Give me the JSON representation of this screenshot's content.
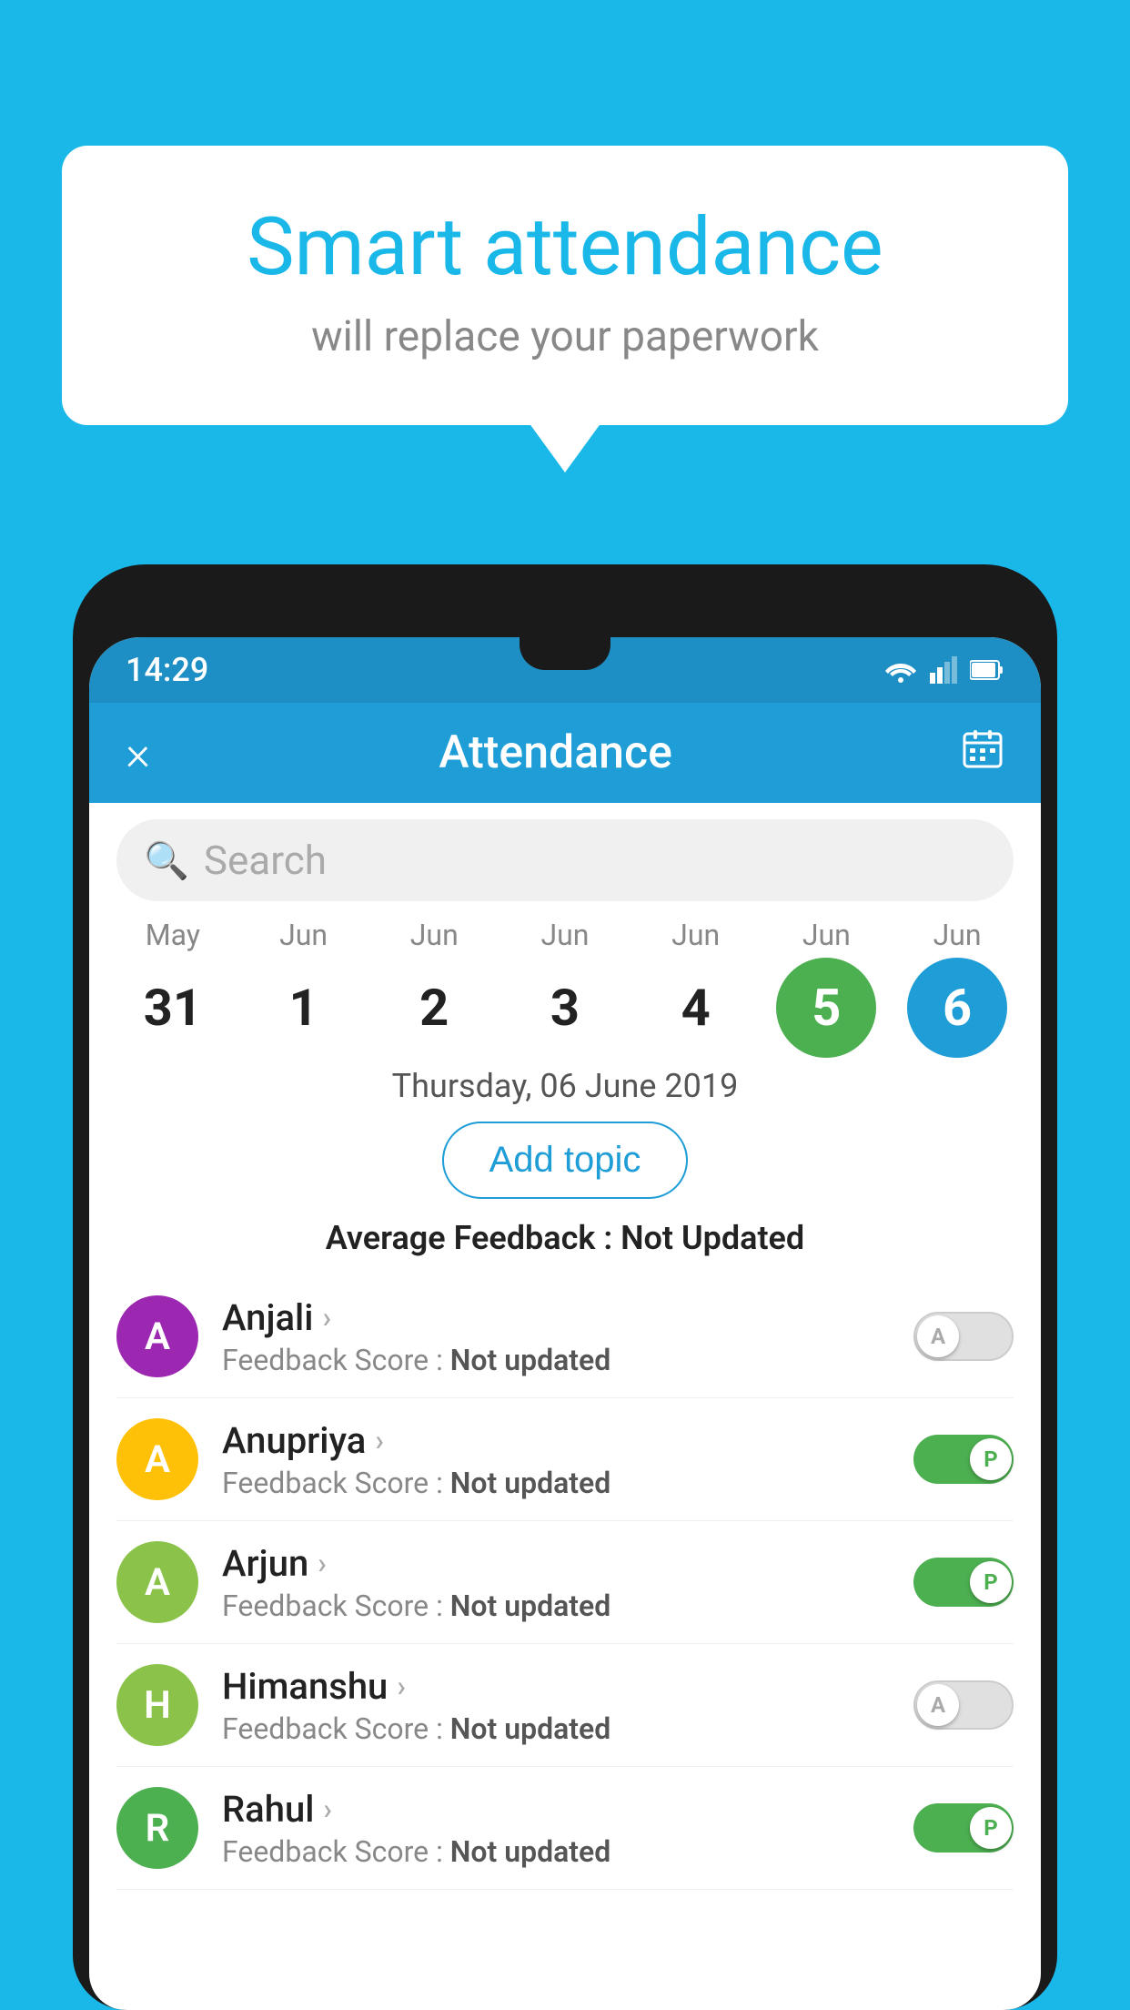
{
  "background_color": "#1ab8e8",
  "speech_bubble": {
    "title": "Smart attendance",
    "subtitle": "will replace your paperwork"
  },
  "status_bar": {
    "time": "14:29"
  },
  "app_bar": {
    "close_label": "×",
    "title": "Attendance",
    "calendar_icon": "📅"
  },
  "search": {
    "placeholder": "Search"
  },
  "calendar": {
    "days": [
      {
        "month": "May",
        "date": "31",
        "state": "normal"
      },
      {
        "month": "Jun",
        "date": "1",
        "state": "normal"
      },
      {
        "month": "Jun",
        "date": "2",
        "state": "normal"
      },
      {
        "month": "Jun",
        "date": "3",
        "state": "normal"
      },
      {
        "month": "Jun",
        "date": "4",
        "state": "normal"
      },
      {
        "month": "Jun",
        "date": "5",
        "state": "today"
      },
      {
        "month": "Jun",
        "date": "6",
        "state": "selected"
      }
    ]
  },
  "selected_date_label": "Thursday, 06 June 2019",
  "add_topic_label": "Add topic",
  "avg_feedback": {
    "label": "Average Feedback :",
    "value": "Not Updated"
  },
  "students": [
    {
      "name": "Anjali",
      "avatar_letter": "A",
      "avatar_color": "#9c27b0",
      "feedback_label": "Feedback Score :",
      "feedback_value": "Not updated",
      "toggle": "off",
      "toggle_label": "A"
    },
    {
      "name": "Anupriya",
      "avatar_letter": "A",
      "avatar_color": "#ffc107",
      "feedback_label": "Feedback Score :",
      "feedback_value": "Not updated",
      "toggle": "on",
      "toggle_label": "P"
    },
    {
      "name": "Arjun",
      "avatar_letter": "A",
      "avatar_color": "#8bc34a",
      "feedback_label": "Feedback Score :",
      "feedback_value": "Not updated",
      "toggle": "on",
      "toggle_label": "P"
    },
    {
      "name": "Himanshu",
      "avatar_letter": "H",
      "avatar_color": "#8bc34a",
      "feedback_label": "Feedback Score :",
      "feedback_value": "Not updated",
      "toggle": "off",
      "toggle_label": "A"
    },
    {
      "name": "Rahul",
      "avatar_letter": "R",
      "avatar_color": "#4caf50",
      "feedback_label": "Feedback Score :",
      "feedback_value": "Not updated",
      "toggle": "on",
      "toggle_label": "P"
    }
  ]
}
